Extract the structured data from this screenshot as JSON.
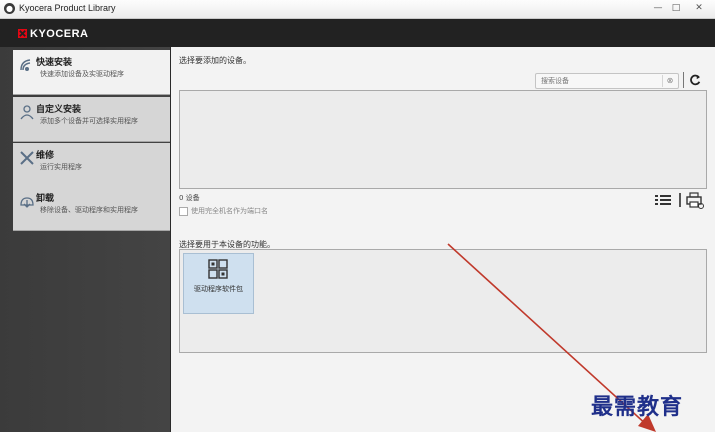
{
  "window": {
    "title": "Kyocera Product Library",
    "minimize": "—",
    "maximize": "□",
    "close": "✕"
  },
  "brand": {
    "logo_text": "KYOCERA",
    "accent": "#e30613"
  },
  "sidebar": {
    "items": [
      {
        "label": "快速安装",
        "desc": "快速添加设备及实驱动程序",
        "icon": "antenna-icon"
      },
      {
        "label": "自定义安装",
        "desc": "添加多个设备并可选择实用程序",
        "icon": "user-icon"
      },
      {
        "label": "维修",
        "desc": "运行实用程序",
        "icon": "tools-icon"
      },
      {
        "label": "卸载",
        "desc": "移除设备、驱动程序和实用程序",
        "icon": "uninstall-icon"
      }
    ]
  },
  "main": {
    "select_device_heading": "选择要添加的设备。",
    "search_placeholder": "搜索设备",
    "search_clear": "⊗",
    "refresh_icon": "refresh-icon",
    "device_count": "0 设备",
    "checkbox_label": "使用完全机名作为端口名",
    "features_heading": "选择要用于本设备的功能。",
    "feature_tile_label": "驱动程序软件包"
  },
  "watermark": {
    "text": "最需教育",
    "color": "#1f2f8a"
  },
  "annotation": {
    "arrow_color": "#c0392b"
  }
}
